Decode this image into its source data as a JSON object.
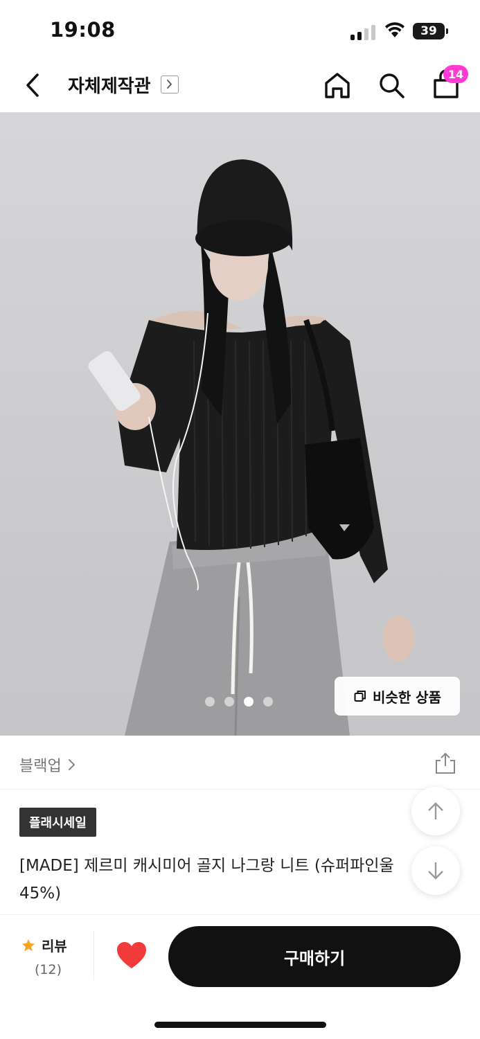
{
  "status_bar": {
    "time": "19:08",
    "battery": "39"
  },
  "header": {
    "store_name": "자체제작관",
    "cart_count": "14",
    "icons": [
      "back-icon",
      "chevron-right-icon",
      "home-icon",
      "search-icon",
      "shopping-bag-icon"
    ]
  },
  "image": {
    "similar_label": "비슷한 상품",
    "total_slides": 4,
    "active_slide": 3
  },
  "brand": {
    "name": "블랙업"
  },
  "product": {
    "badge": "플래시세일",
    "title_line1": "[MADE] 제르미 캐시미어 골지 나그랑 니트 (슈퍼파인울",
    "title_line2": "45%)"
  },
  "bottom_bar": {
    "review_label": "리뷰",
    "review_count": "(12)",
    "buy_label": "구매하기"
  },
  "colors": {
    "accent_badge": "#ff3bd4",
    "heart": "#f23b3b",
    "star": "#f5a623",
    "button": "#111111"
  }
}
